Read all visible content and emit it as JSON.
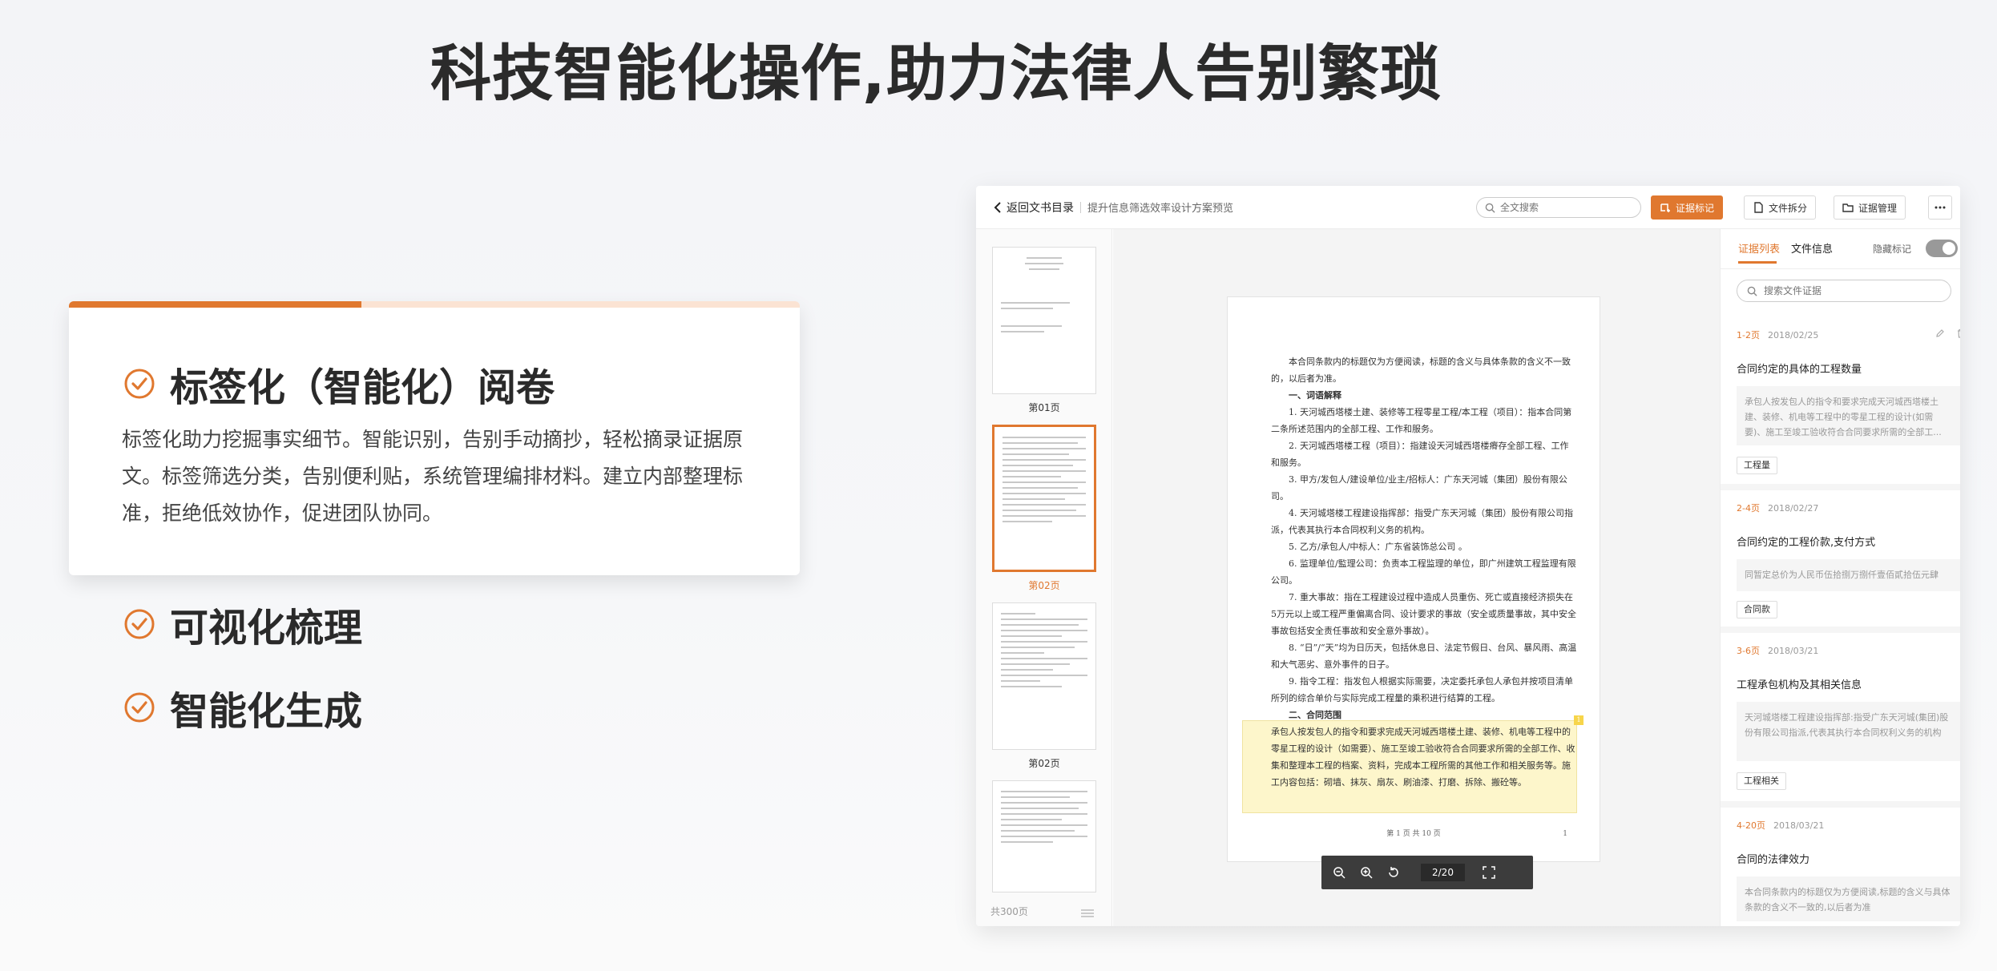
{
  "headline": "科技智能化操作,助力法律人告别繁琐",
  "features": {
    "card": {
      "title": "标签化（智能化）阅卷",
      "description": "标签化助力挖掘事实细节。智能识别，告别手动摘抄，轻松摘录证据原文。标签筛选分类，告别便利贴，系统管理编排材料。建立内部整理标准，拒绝低效协作，促进团队协同。",
      "progress": 0.4
    },
    "items": [
      {
        "title": "可视化梳理"
      },
      {
        "title": "智能化生成"
      }
    ]
  },
  "colors": {
    "accent": "#e0782f",
    "highlight": "#fdf6cb"
  },
  "app": {
    "back_label": "返回文书目录",
    "doc_name": "提升信息筛选效率设计方案预览",
    "search_placeholder": "全文搜索",
    "buttons": {
      "mark": "证据标记",
      "split": "文件拆分",
      "manage": "证据管理"
    },
    "thumbnails": [
      {
        "label": "第01页",
        "active": false
      },
      {
        "label": "第02页",
        "active": true
      },
      {
        "label": "第02页",
        "active": false
      },
      {
        "label": "",
        "active": false
      }
    ],
    "total_pages": "共300页",
    "document": {
      "paragraphs": [
        "本合同条款内的标题仅为方便阅读，标题的含义与具体条款的含义不一致的，以后者为准。",
        "一、词语解释",
        "1. 天河城西塔楼土建、装修等工程零星工程/本工程（项目）：指本合同第二条所述范围内的全部工程、工作和服务。",
        "2. 天河城西塔楼工程（项目）：指建设天河城西塔楼瘠存全部工程、工作和服务。",
        "3. 甲方/发包人/建设单位/业主/招标人：广东天河城（集团）股份有限公司。",
        "4. 天河城塔楼工程建设指挥部：指受广东天河城（集团）股份有限公司指派，代表其执行本合同权利义务的机构。",
        "5. 乙方/承包人/中标人：广东省装饰总公司 。",
        "6. 监理单位/監理公司：负责本工程监理的单位，即广州建筑工程监理有限公司。",
        "7. 重大事故：指在工程建设过程中造成人员重伤、死亡或直接经济损失在5万元以上或工程严重偏离合同、设计要求的事故（安全或质量事故，其中安全事故包括安全责任事故和安全意外事故）。",
        "8. “日”/“天”均为日历天，包括休息日、法定节假日、台风、暴风雨、高温和大气恶劣、意外事件的日子。",
        "9. 指令工程：指发包人根据实际需要，决定委托承包人承包并按项目清单所列的综合单价与实际完成工程量的乘积进行结算的工程。",
        "二、合同范围"
      ],
      "highlight": "承包人按发包人的指令和要求完成天河城西塔楼土建、装修、机电等工程中的零星工程的设计（如需要）、施工至竣工验收符合合同要求所需的全部工作、收集和整理本工程的档案、资料，完成本工程所需的其他工作和相关服务等。施工内容包括：砌墙、抹灰、扇灰、刷油漆、打磨、拆除、搬砼等。",
      "highlight_badge": "1",
      "footer": "第 1 页 共 10 页",
      "footer_right": "1"
    },
    "zoom": {
      "page": "2/20"
    },
    "panel": {
      "tabs": [
        "证据列表",
        "文件信息"
      ],
      "hide_label": "隐藏标记",
      "search_placeholder": "搜索文件证据",
      "evidence": [
        {
          "pages": "1-2页",
          "date": "2018/02/25",
          "title": "合同约定的具体的工程数量",
          "quote": "承包人按发包人的指令和要求完成天河城西塔楼土建、装修、机电等工程中的零星工程的设计(如需要)、施工至竣工验收符合合同要求所需的全部工...",
          "tag": "工程量"
        },
        {
          "pages": "2-4页",
          "date": "2018/02/27",
          "title": "合同约定的工程价款,支付方式",
          "quote": "同暂定总价为人民币伍拾捌万捌仟壹佰貳拾伍元肆",
          "tag": "合同款"
        },
        {
          "pages": "3-6页",
          "date": "2018/03/21",
          "title": "工程承包机构及其相关信息",
          "quote": "天河城塔楼工程建设指挥部:指受广东天河城(集团)股份有限公司指派,代表其执行本合同权利义务的机构",
          "tag": "工程相关"
        },
        {
          "pages": "4-20页",
          "date": "2018/03/21",
          "title": "合同的法律效力",
          "quote": "本合同条款内的标题仅为方便阅读,标题的含义与具体条款的含义不一致的,以后者为准",
          "tag": ""
        }
      ]
    }
  }
}
